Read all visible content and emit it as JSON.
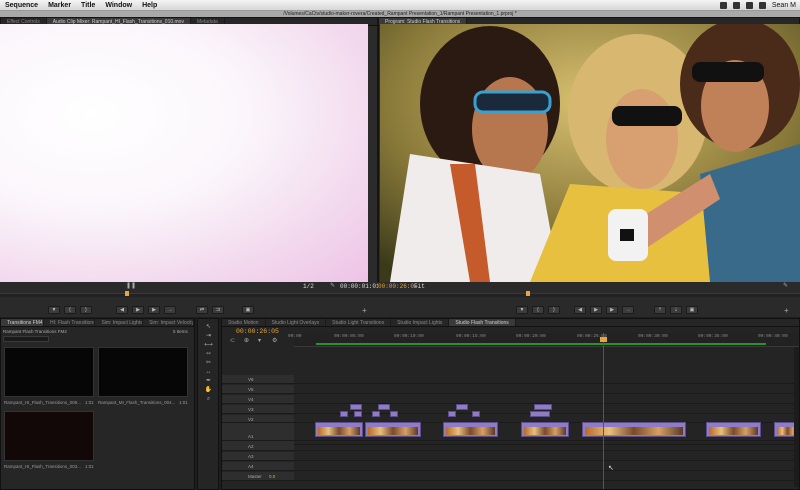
{
  "menubar": {
    "items": [
      "Sequence",
      "Marker",
      "Title",
      "Window",
      "Help"
    ],
    "user": "Sean M"
  },
  "titlebar": {
    "path": "/Volumes/CaCtv/studio-maker-rovera/Created_Rampant Presentation_1/Rampant Presentation_1.prproj *"
  },
  "source_monitor": {
    "tabs": [
      "Effect Controls",
      "Audio Clip Mixer: Rampant_HI_Flash_Transitions_010.mov",
      "Metadata"
    ],
    "timecode": "00:00:01:01",
    "zoom": "1/2"
  },
  "program_monitor": {
    "tabs": [
      "Program: Studio Flash Transitions"
    ],
    "timecode_left": "00:00:26:05",
    "zoom": "Fit"
  },
  "project_panel": {
    "tabs": [
      "Transitions FM4",
      "HI: Flash Transitions",
      "Sim: Impact Lights",
      "Sim: Impact Velocity"
    ],
    "bin_label": "Rampant Flash Transitions FM4",
    "item_count": "5 Items",
    "clips": [
      {
        "name": "Rampant_HI_Flash_Transitions_008...",
        "dur": "1:01"
      },
      {
        "name": "Rampant_MI_Flash_Transitions_004...",
        "dur": "1:01"
      },
      {
        "name": "Rampant_HI_Flash_Transitions_003...",
        "dur": "1:01"
      }
    ]
  },
  "timeline": {
    "tabs": [
      "Studio Motion",
      "Studio Light Overlays",
      "Studio Light Transitions",
      "Studio Impact Lights",
      "Studio Flash Transitions"
    ],
    "timecode": "00:00:26:05",
    "ruler": [
      "00:00",
      "00:00:05:00",
      "00:00:10:00",
      "00:00:15:00",
      "00:00:20:00",
      "00:00:25:00",
      "00:00:30:00",
      "00:00:35:00",
      "00:00:40:00"
    ],
    "video_tracks": [
      "V6",
      "V5",
      "V4",
      "V3",
      "V2",
      "V1"
    ],
    "audio_tracks": [
      "A1",
      "A2",
      "A3",
      "A4"
    ],
    "master_label": "Master",
    "master_value": "0.0"
  },
  "colors": {
    "accent": "#e8a53a",
    "clip": "#8f7bc6",
    "playhead": "#d02020"
  }
}
